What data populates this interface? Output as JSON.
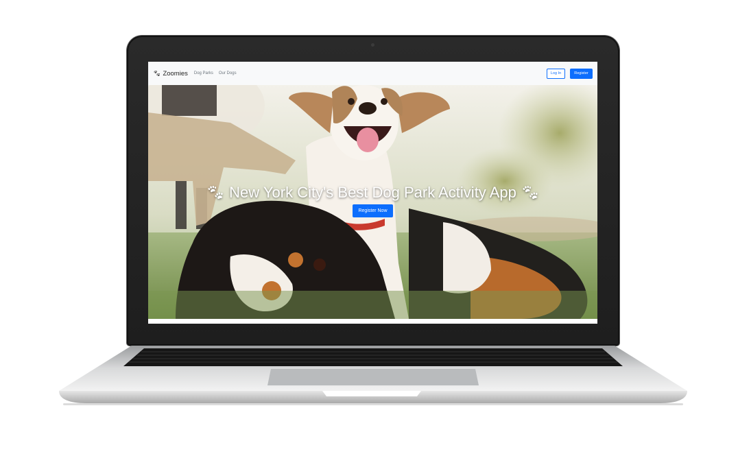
{
  "navbar": {
    "brand_icon": "paw-icon",
    "brand": "Zoomies",
    "links": [
      "Dog Parks",
      "Our Dogs"
    ],
    "login_label": "Log In",
    "register_label": "Register"
  },
  "hero": {
    "title_icon": "paw-icon",
    "title": "New York City's Best Dog Park Activity App",
    "cta_label": "Register Now"
  },
  "colors": {
    "primary": "#0d6efd",
    "navbar_bg": "#f8f9fa",
    "bezel": "#222222"
  }
}
